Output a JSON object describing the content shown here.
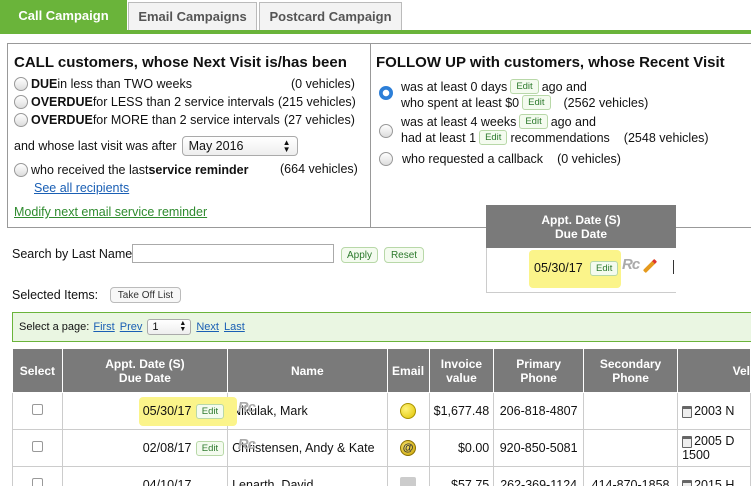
{
  "tabs": [
    "Call Campaign",
    "Email Campaigns",
    "Postcard Campaign"
  ],
  "call": {
    "title": "CALL customers, whose Next Visit is/has been",
    "options": [
      {
        "bold": "DUE",
        "text": " in less than TWO weeks",
        "count": "(0 vehicles)"
      },
      {
        "bold": "OVERDUE",
        "text": " for LESS than 2 service intervals",
        "count": "(215 vehicles)"
      },
      {
        "bold": "OVERDUE",
        "text": " for MORE than 2 service intervals",
        "count": "(27 vehicles)"
      }
    ],
    "last_visit_label": "and whose last visit was after",
    "last_visit_value": "May 2016",
    "reminder_pre": "who received the last ",
    "reminder_bold": "service reminder",
    "reminder_count": "(664 vehicles)",
    "see_all": "See all recipients",
    "modify": "Modify next email service reminder"
  },
  "followup": {
    "title": "FOLLOW UP with customers, whose Recent Visit",
    "o1_a": "was at least 0 days",
    "o1_b": "ago and",
    "o1_c": "who spent at least $0",
    "o1_count": "(2562 vehicles)",
    "o2_a": "was at least 4 weeks",
    "o2_b": "ago and",
    "o2_c": "had at least 1",
    "o2_d": "recommendations",
    "o2_count": "(2548 vehicles)",
    "o3": "who requested a callback",
    "o3_count": "(0 vehicles)"
  },
  "edit_label": "Edit",
  "floating": {
    "head1": "Appt. Date (S)",
    "head2": "Due Date",
    "date": "05/30/17",
    "rc": "Rc"
  },
  "search": {
    "label": "Search by Last Name:",
    "apply": "Apply",
    "reset": "Reset"
  },
  "selected": {
    "label": "Selected Items:",
    "button": "Take Off List"
  },
  "pager": {
    "label": "Select a page:",
    "first": "First",
    "prev": "Prev",
    "page": "1",
    "next": "Next",
    "last": "Last"
  },
  "columns": [
    "Select",
    "Appt. Date (S)",
    "Due Date",
    "Name",
    "Email",
    "Invoice",
    "value",
    "Primary",
    "Phone",
    "Secondary",
    "Phone",
    "Vel"
  ],
  "rows": [
    {
      "date": "05/30/17",
      "name": "Nikulak, Mark",
      "invoice": "$1,677.48",
      "primary": "206-818-4807",
      "secondary": "",
      "vehicle": "2003 N"
    },
    {
      "date": "02/08/17",
      "name": "Christensen, Andy & Kate",
      "invoice": "$0.00",
      "primary": "920-850-5081",
      "secondary": "",
      "vehicle": "2005 D",
      "vehicle2": "1500"
    },
    {
      "date": "04/10/17",
      "name": "Lenarth, David",
      "invoice": "$57.75",
      "primary": "262-369-1124",
      "secondary": "414-870-1858",
      "vehicle": "2015 H"
    }
  ],
  "colors": {
    "green": "#6ab43a",
    "header_gray": "#7a7a7a",
    "highlight": "#fbf48a",
    "link": "#1a5fb4"
  }
}
